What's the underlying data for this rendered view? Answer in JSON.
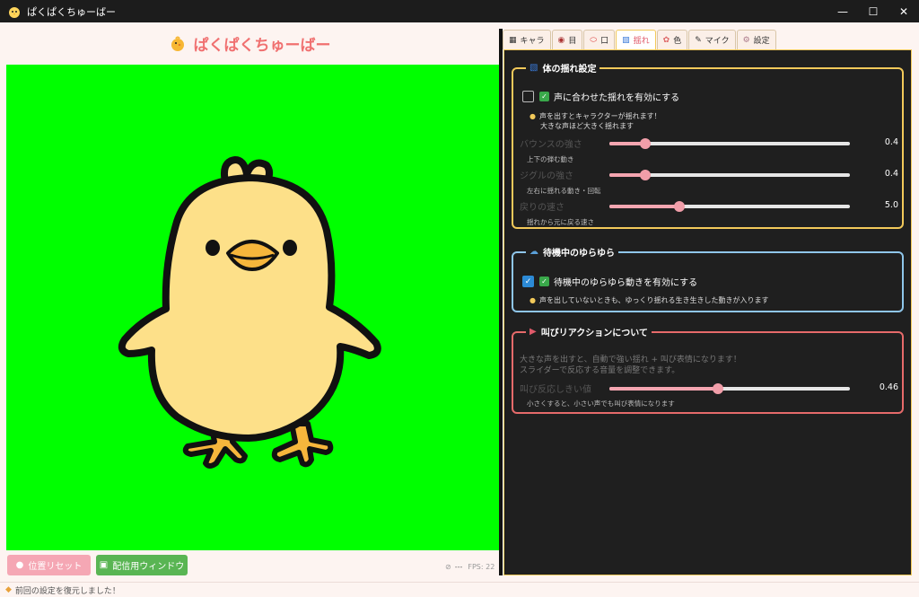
{
  "window": {
    "title": "ぱくぱくちゅーばー",
    "min_icon": "minimize-icon",
    "max_icon": "maximize-icon",
    "close_icon": "close-icon"
  },
  "left": {
    "heading": "ぱくぱくちゅーばー",
    "preview_bg": "#00ff00",
    "reset_button": "位置リセット",
    "window_button": "配信用ウィンドウ",
    "status_dash": "---",
    "fps": "FPS: 22"
  },
  "statusbar": {
    "message": "前回の設定を復元しました！"
  },
  "tabs": [
    {
      "label": "キャラ",
      "icon": "image-icon"
    },
    {
      "label": "目",
      "icon": "eye-icon"
    },
    {
      "label": "口",
      "icon": "mouth-icon"
    },
    {
      "label": "揺れ",
      "icon": "shake-icon"
    },
    {
      "label": "色",
      "icon": "palette-icon"
    },
    {
      "label": "マイク",
      "icon": "mic-icon"
    },
    {
      "label": "設定",
      "icon": "settings-icon"
    }
  ],
  "active_tab": "揺れ",
  "body_shake": {
    "title": "体の揺れ設定",
    "enable_label": "声に合わせた揺れを有効にする",
    "enabled": false,
    "hint_line1": "声を出すとキャラクターが揺れます！",
    "hint_line2": "大きな声ほど大きく揺れます",
    "sliders": [
      {
        "label": "バウンスの強さ",
        "sub": "上下の弾む動き",
        "value": 0.4,
        "display": "0.4",
        "ratio": 0.15
      },
      {
        "label": "ジグルの強さ",
        "sub": "左右に揺れる動き・回転",
        "value": 0.4,
        "display": "0.4",
        "ratio": 0.15
      },
      {
        "label": "戻りの速さ",
        "sub": "揺れから元に戻る速さ",
        "value": 5.0,
        "display": "5.0",
        "ratio": 0.29
      }
    ]
  },
  "idle": {
    "title": "待機中のゆらゆら",
    "enable_label": "待機中のゆらゆら動きを有効にする",
    "enabled": true,
    "hint": "声を出していないときも、ゆっくり揺れる生き生きした動きが入ります"
  },
  "shout": {
    "title": "叫びリアクションについて",
    "desc_line1": "大きな声を出すと、自動で強い揺れ + 叫び表情になります！",
    "desc_line2": "スライダーで反応する音量を調整できます。",
    "slider": {
      "label": "叫び反応しきい値",
      "sub": "小さくすると、小さい声でも叫び表情になります",
      "value": 0.46,
      "display": "0.46",
      "ratio": 0.45
    }
  },
  "colors": {
    "accent_pink": "#f4a5b0",
    "group1": "#f2c95a",
    "group2": "#8fc6ea",
    "group3": "#e66a6a",
    "green_button": "#59b553"
  }
}
